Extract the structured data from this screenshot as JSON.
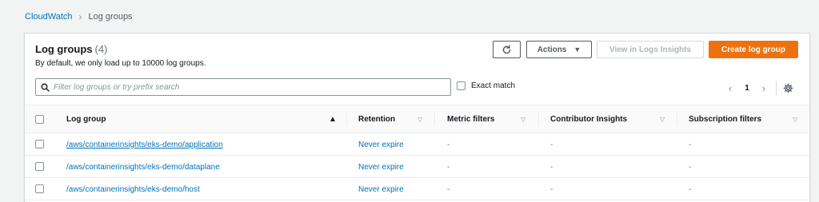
{
  "breadcrumb": {
    "root": "CloudWatch",
    "separator": "›",
    "current": "Log groups"
  },
  "panel": {
    "title": "Log groups",
    "count": "(4)",
    "description": "By default, we only load up to 10000 log groups."
  },
  "toolbar": {
    "refresh_icon": "refresh-icon",
    "actions_label": "Actions",
    "actions_caret": "▼",
    "insights_label": "View in Logs Insights",
    "create_label": "Create log group"
  },
  "search": {
    "placeholder": "Filter log groups or try prefix search",
    "value": "",
    "icon": "search-icon"
  },
  "exact_match": {
    "label": "Exact match",
    "checked": false
  },
  "pagination": {
    "prev": "‹",
    "page": "1",
    "next": "›",
    "settings_icon": "gear-icon"
  },
  "table": {
    "columns": [
      {
        "label": "Log group",
        "sort": "▲"
      },
      {
        "label": "Retention",
        "sort": "▽"
      },
      {
        "label": "Metric filters",
        "sort": "▽"
      },
      {
        "label": "Contributor Insights",
        "sort": "▽"
      },
      {
        "label": "Subscription filters",
        "sort": "▽"
      }
    ],
    "rows": [
      {
        "log_group": "/aws/containerinsights/eks-demo/application",
        "retention": "Never expire",
        "metric_filters": "-",
        "contributor_insights": "-",
        "subscription_filters": "-"
      },
      {
        "log_group": "/aws/containerinsights/eks-demo/dataplane",
        "retention": "Never expire",
        "metric_filters": "-",
        "contributor_insights": "-",
        "subscription_filters": "-"
      },
      {
        "log_group": "/aws/containerinsights/eks-demo/host",
        "retention": "Never expire",
        "metric_filters": "-",
        "contributor_insights": "-",
        "subscription_filters": "-"
      }
    ]
  },
  "colors": {
    "link": "#0073bb",
    "primary": "#ec7211",
    "background": "#f2f3f3"
  }
}
